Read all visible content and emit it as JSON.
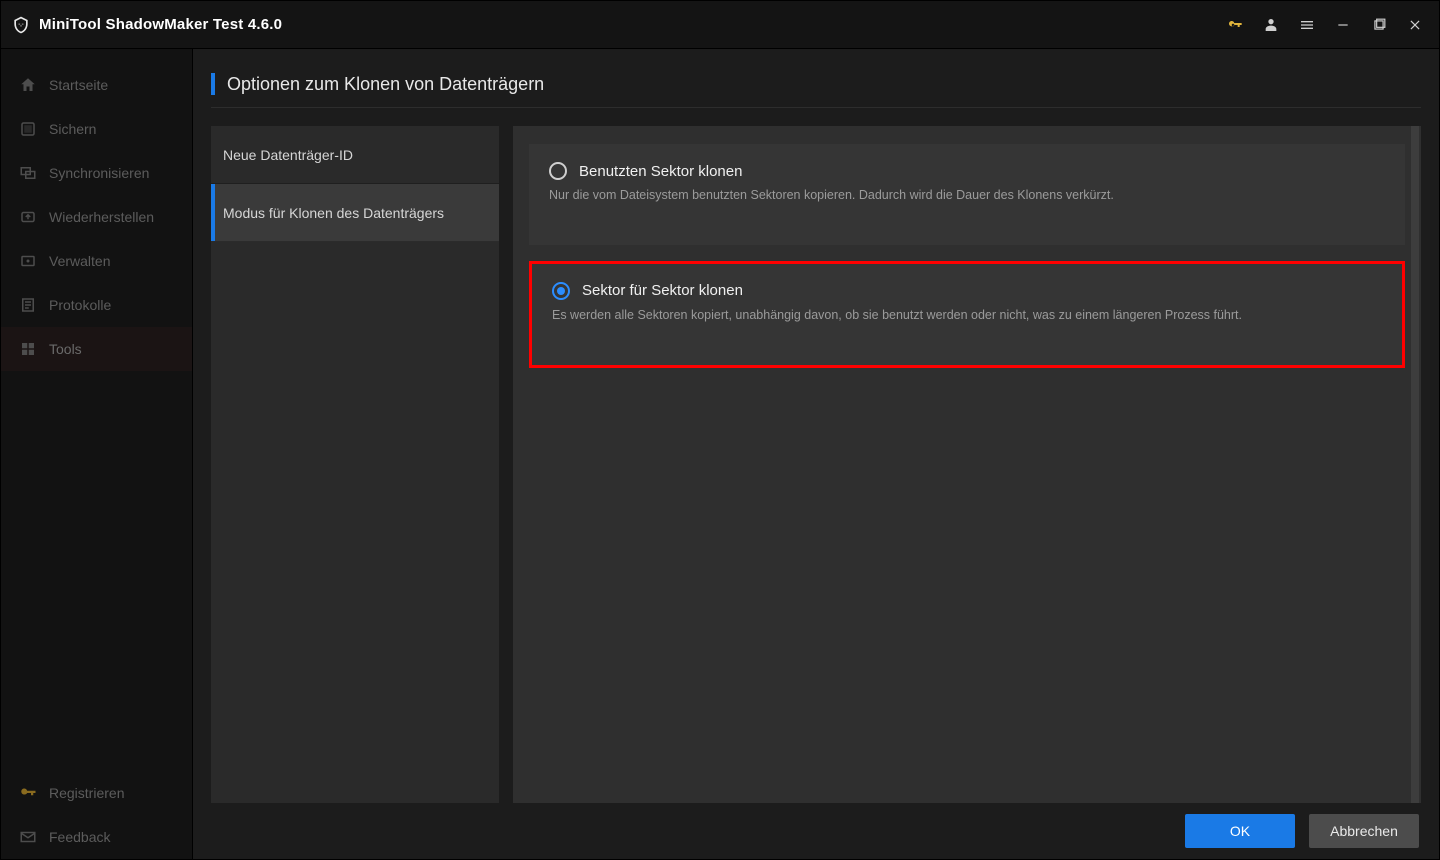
{
  "app": {
    "title": "MiniTool ShadowMaker Test 4.6.0"
  },
  "titlebar_icons": {
    "key": "key-icon",
    "user": "user-icon",
    "menu": "menu-icon",
    "minimize": "minimize-icon",
    "maximize": "maximize-icon",
    "close": "close-icon"
  },
  "sidebar": {
    "items": [
      {
        "label": "Startseite",
        "icon": "home-icon"
      },
      {
        "label": "Sichern",
        "icon": "backup-icon"
      },
      {
        "label": "Synchronisieren",
        "icon": "sync-icon"
      },
      {
        "label": "Wiederherstellen",
        "icon": "restore-icon"
      },
      {
        "label": "Verwalten",
        "icon": "manage-icon"
      },
      {
        "label": "Protokolle",
        "icon": "log-icon"
      },
      {
        "label": "Tools",
        "icon": "tools-icon"
      }
    ],
    "bottom": [
      {
        "label": "Registrieren",
        "icon": "key-icon"
      },
      {
        "label": "Feedback",
        "icon": "mail-icon"
      }
    ],
    "active_index": 6
  },
  "page": {
    "title": "Optionen zum Klonen von Datenträgern"
  },
  "subpanel": {
    "items": [
      {
        "label": "Neue Datenträger-ID"
      },
      {
        "label": "Modus für Klonen des Datenträgers"
      }
    ],
    "active_index": 1
  },
  "options": [
    {
      "title": "Benutzten Sektor klonen",
      "desc": "Nur die vom Dateisystem benutzten Sektoren kopieren. Dadurch wird die Dauer des Klonens verkürzt.",
      "selected": false,
      "highlight": false
    },
    {
      "title": "Sektor für Sektor klonen",
      "desc": "Es werden alle Sektoren kopiert, unabhängig davon, ob sie benutzt werden oder nicht, was zu einem längeren Prozess führt.",
      "selected": true,
      "highlight": true
    }
  ],
  "footer": {
    "ok": "OK",
    "cancel": "Abbrechen"
  },
  "colors": {
    "accent": "#1a7ae6",
    "highlight": "#ff0000"
  }
}
